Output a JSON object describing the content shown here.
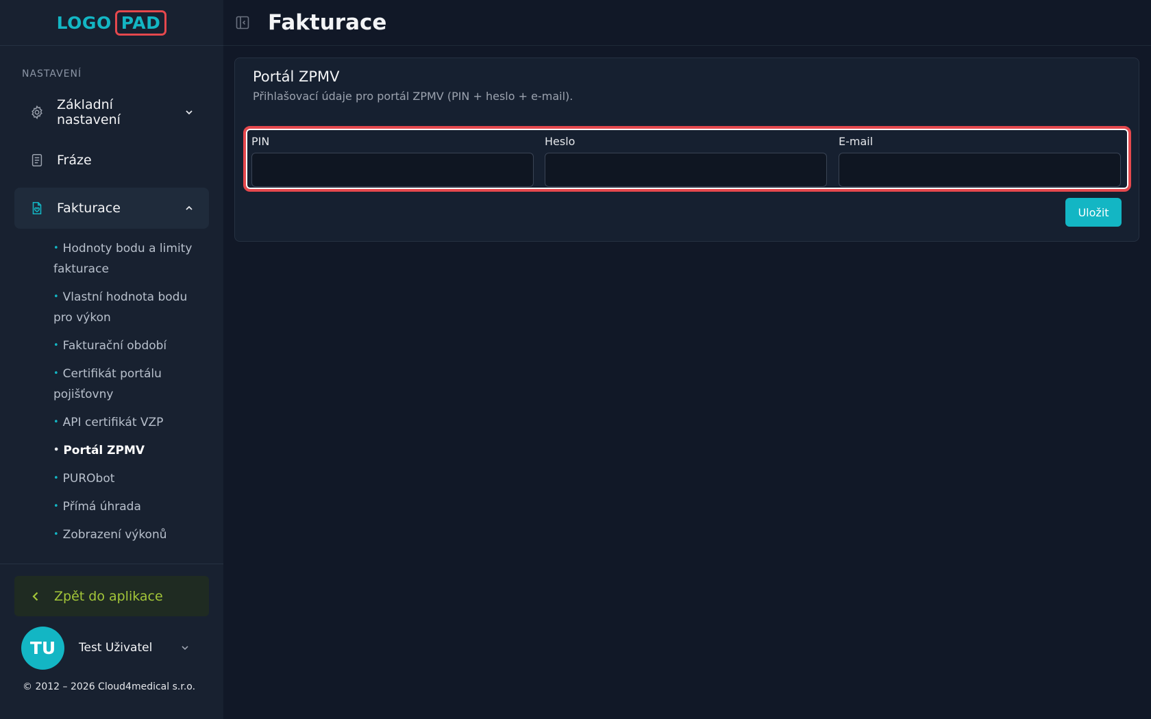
{
  "logo": {
    "part1": "LOGO",
    "part2": "PAD"
  },
  "sidebar": {
    "section_label": "NASTAVENÍ",
    "items": [
      {
        "label": "Základní nastavení",
        "icon": "gear-icon"
      },
      {
        "label": "Fráze",
        "icon": "document-icon"
      },
      {
        "label": "Fakturace",
        "icon": "invoice-icon"
      }
    ],
    "sub_items": [
      "Hodnoty bodu a limity fakturace",
      "Vlastní hodnota bodu pro výkon",
      "Fakturační období",
      "Certifikát portálu pojišťovny",
      "API certifikát VZP",
      "Portál ZPMV",
      "PURObot",
      "Přímá úhrada",
      "Zobrazení výkonů"
    ],
    "back_label": "Zpět do aplikace",
    "user": {
      "initials": "TU",
      "name": "Test Uživatel"
    },
    "copyright": "© 2012 – 2026 Cloud4medical s.r.o."
  },
  "header": {
    "title": "Fakturace"
  },
  "card": {
    "title": "Portál ZPMV",
    "description": "Přihlašovací údaje pro portál ZPMV (PIN + heslo + e-mail).",
    "fields": [
      {
        "label": "PIN",
        "value": "",
        "placeholder": ""
      },
      {
        "label": "Heslo",
        "value": "",
        "placeholder": ""
      },
      {
        "label": "E-mail",
        "value": "",
        "placeholder": ""
      }
    ],
    "save_label": "Uložit"
  },
  "colors": {
    "accent": "#13b6c4",
    "highlight_border": "#e5484d",
    "back_text": "#a3c639",
    "background": "#111827",
    "sidebar": "#182130"
  }
}
